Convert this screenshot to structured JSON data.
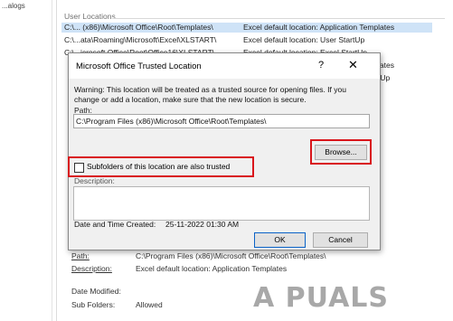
{
  "left_pane": {
    "cut_text": "...alogs"
  },
  "section": {
    "title": "User Locations"
  },
  "locations": [
    {
      "path": "C:\\... (x86)\\Microsoft Office\\Root\\Templates\\",
      "description": "Excel default location: Application Templates",
      "selected": true
    },
    {
      "path": "C:\\...ata\\Roaming\\Microsoft\\Excel\\XLSTART\\",
      "description": "Excel default location: User StartUp",
      "selected": false
    },
    {
      "path": "C:\\...icrosoft Office\\Root\\Office16\\XLSTART\\",
      "description": "Excel default location: Excel StartUp",
      "selected": false
    }
  ],
  "row_tails": [
    "lates",
    "tUp"
  ],
  "details": {
    "path_label": "Path:",
    "path_value": "C:\\Program Files (x86)\\Microsoft Office\\Root\\Templates\\",
    "description_label": "Description:",
    "description_value": "Excel default location: Application Templates",
    "date_modified_label": "Date Modified:",
    "subfolders_label": "Sub Folders:",
    "subfolders_value": "Allowed"
  },
  "dialog": {
    "title": "Microsoft Office Trusted Location",
    "help_glyph": "?",
    "close_glyph": "✕",
    "warning": "Warning: This location will be treated as a trusted source for opening files. If you change or add a location, make sure that the new location is secure.",
    "path_label": "Path:",
    "path_value": "C:\\Program Files (x86)\\Microsoft Office\\Root\\Templates\\",
    "browse_label": "Browse...",
    "subfolders_label": "Subfolders of this location are also trusted",
    "subfolders_checked": false,
    "description_label": "Description:",
    "description_value": "",
    "date_label": "Date and Time Created:",
    "date_value": "25-11-2022 01:30 AM",
    "ok_label": "OK",
    "cancel_label": "Cancel"
  },
  "watermark": "A PUALS",
  "colors": {
    "highlight_red": "#d9151b",
    "selection_blue": "#cfe3f7",
    "ok_border": "#0a63c7"
  }
}
